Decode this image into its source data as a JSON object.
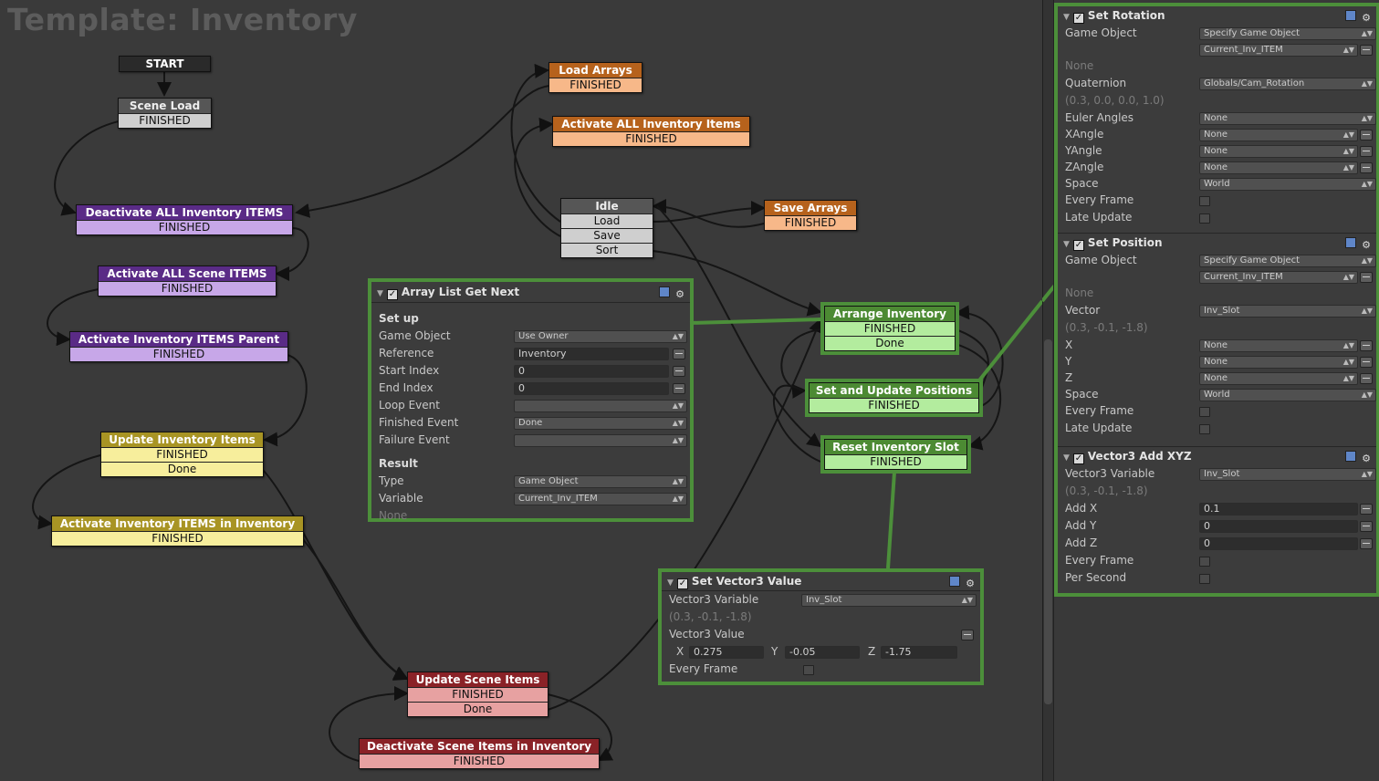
{
  "title": "Template: Inventory",
  "nodes": {
    "start": {
      "header": "START"
    },
    "scene_load": {
      "header": "Scene Load",
      "rows": [
        "FINISHED"
      ]
    },
    "load_arrays": {
      "header": "Load Arrays",
      "rows": [
        "FINISHED"
      ]
    },
    "activate_all_inv": {
      "header": "Activate ALL Inventory Items",
      "rows": [
        "FINISHED"
      ]
    },
    "idle": {
      "header": "Idle",
      "rows": [
        "Load",
        "Save",
        "Sort"
      ]
    },
    "save_arrays": {
      "header": "Save Arrays",
      "rows": [
        "FINISHED"
      ]
    },
    "deactivate_all_inv": {
      "header": "Deactivate ALL Inventory ITEMS",
      "rows": [
        "FINISHED"
      ]
    },
    "activate_all_scene": {
      "header": "Activate ALL Scene ITEMS",
      "rows": [
        "FINISHED"
      ]
    },
    "activate_inv_parent": {
      "header": "Activate Inventory ITEMS Parent",
      "rows": [
        "FINISHED"
      ]
    },
    "update_inv": {
      "header": "Update Inventory Items",
      "rows": [
        "FINISHED",
        "Done"
      ]
    },
    "activate_inv_in_inv": {
      "header": "Activate Inventory ITEMS in Inventory",
      "rows": [
        "FINISHED"
      ]
    },
    "arrange_inv": {
      "header": "Arrange Inventory",
      "rows": [
        "FINISHED",
        "Done"
      ]
    },
    "set_update_pos": {
      "header": "Set and Update Positions",
      "rows": [
        "FINISHED"
      ]
    },
    "reset_slot": {
      "header": "Reset Inventory Slot",
      "rows": [
        "FINISHED"
      ]
    },
    "update_scene": {
      "header": "Update Scene Items",
      "rows": [
        "FINISHED",
        "Done"
      ]
    },
    "deactivate_scene_in_inv": {
      "header": "Deactivate Scene Items in Inventory",
      "rows": [
        "FINISHED"
      ]
    }
  },
  "array_panel": {
    "title": "Array List Get Next",
    "setup": "Set up",
    "game_object_label": "Game Object",
    "game_object": "Use Owner",
    "reference_label": "Reference",
    "reference": "Inventory",
    "start_index_label": "Start Index",
    "start_index": "0",
    "end_index_label": "End Index",
    "end_index": "0",
    "loop_event_label": "Loop Event",
    "loop_event": "",
    "finished_event_label": "Finished Event",
    "finished_event": "Done",
    "failure_event_label": "Failure Event",
    "failure_event": "",
    "result": "Result",
    "type_label": "Type",
    "type": "Game Object",
    "variable_label": "Variable",
    "variable": "Current_Inv_ITEM",
    "none": "None"
  },
  "vec3_panel": {
    "title": "Set Vector3 Value",
    "var_label": "Vector3 Variable",
    "var": "Inv_Slot",
    "hint": "(0.3, -0.1, -1.8)",
    "value_label": "Vector3 Value",
    "x_label": "X",
    "x": "0.275",
    "y_label": "Y",
    "y": "-0.05",
    "z_label": "Z",
    "z": "-1.75",
    "every_frame_label": "Every Frame"
  },
  "inspector": {
    "set_rotation": {
      "title": "Set Rotation",
      "game_object_label": "Game Object",
      "game_object": "Specify Game Object",
      "game_object_var": "Current_Inv_ITEM",
      "none": "None",
      "quaternion_label": "Quaternion",
      "quaternion": "Globals/Cam_Rotation",
      "quaternion_hint": "(0.3, 0.0, 0.0, 1.0)",
      "euler_label": "Euler Angles",
      "euler": "None",
      "xangle_label": "XAngle",
      "xangle": "None",
      "yangle_label": "YAngle",
      "yangle": "None",
      "zangle_label": "ZAngle",
      "zangle": "None",
      "space_label": "Space",
      "space": "World",
      "every_frame_label": "Every Frame",
      "late_update_label": "Late Update"
    },
    "set_position": {
      "title": "Set Position",
      "game_object_label": "Game Object",
      "game_object": "Specify Game Object",
      "game_object_var": "Current_Inv_ITEM",
      "none": "None",
      "vector_label": "Vector",
      "vector": "Inv_Slot",
      "vector_hint": "(0.3, -0.1, -1.8)",
      "x_label": "X",
      "x": "None",
      "y_label": "Y",
      "y": "None",
      "z_label": "Z",
      "z": "None",
      "space_label": "Space",
      "space": "World",
      "every_frame_label": "Every Frame",
      "late_update_label": "Late Update"
    },
    "vector3_add": {
      "title": "Vector3 Add XYZ",
      "var_label": "Vector3 Variable",
      "var": "Inv_Slot",
      "hint": "(0.3, -0.1, -1.8)",
      "addx_label": "Add X",
      "addx": "0.1",
      "addy_label": "Add Y",
      "addy": "0",
      "addz_label": "Add Z",
      "addz": "0",
      "every_frame_label": "Every Frame",
      "per_second_label": "Per Second"
    }
  },
  "colors": {
    "selection": "#4c8f3a",
    "background": "#3a3a3a"
  }
}
